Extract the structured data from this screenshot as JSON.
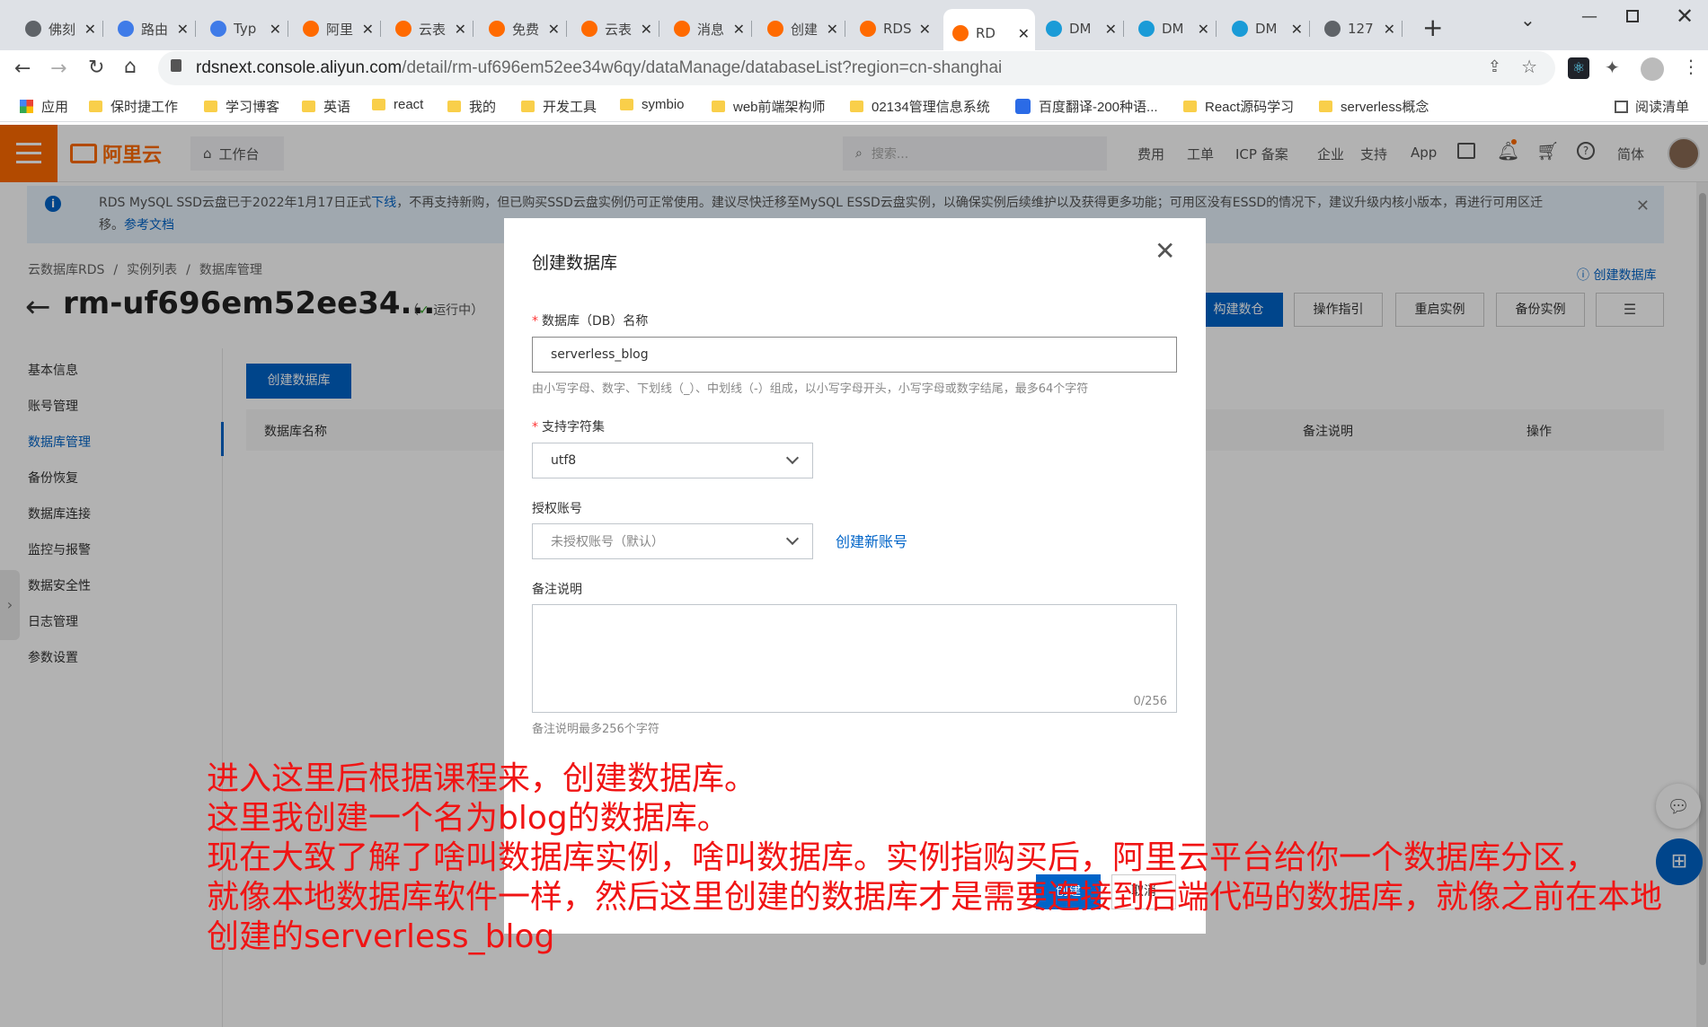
{
  "browser": {
    "tabs": [
      {
        "label": "佛刻",
        "color": "#5f6368"
      },
      {
        "label": "路由",
        "color": "#3f7be8"
      },
      {
        "label": "Typ",
        "color": "#3f7be8"
      },
      {
        "label": "阿里",
        "color": "#ff6a00"
      },
      {
        "label": "云表",
        "color": "#ff6a00"
      },
      {
        "label": "免费",
        "color": "#ff6a00"
      },
      {
        "label": "云表",
        "color": "#ff6a00"
      },
      {
        "label": "消息",
        "color": "#ff6a00"
      },
      {
        "label": "创建",
        "color": "#ff6a00"
      },
      {
        "label": "RDS",
        "color": "#ff6a00"
      },
      {
        "label": "RD",
        "color": "#ff6a00"
      },
      {
        "label": "DM",
        "color": "#1a9bd7"
      },
      {
        "label": "DM",
        "color": "#1a9bd7"
      },
      {
        "label": "DM",
        "color": "#1a9bd7"
      },
      {
        "label": "127",
        "color": "#5f6368"
      }
    ],
    "url_host": "rdsnext.console.aliyun.com",
    "url_path": "/detail/rm-uf696em52ee34w6qy/dataManage/databaseList?region=cn-shanghai",
    "bookmarks": [
      "应用",
      "保时捷工作",
      "学习博客",
      "英语",
      "react",
      "我的",
      "开发工具",
      "symbio",
      "web前端架构师",
      "02134管理信息系统",
      "百度翻译-200种语...",
      "React源码学习",
      "serverless概念"
    ],
    "reading_list": "阅读清单"
  },
  "console": {
    "logo": "阿里云",
    "workbench": "工作台",
    "search_placeholder": "搜索...",
    "nav": [
      "费用",
      "工单",
      "ICP 备案",
      "企业",
      "支持",
      "App"
    ],
    "lang": "简体",
    "notice_a": "RDS MySQL SSD云盘已于2022年1月17日正式",
    "notice_link": "下线",
    "notice_b": "，不再支持新购，但已购买SSD云盘实例仍可正常使用。建议尽快迁移至MySQL ESSD云盘实例，以确保实例后续维护以及获得更多功能；可用区没有ESSD的情况下，建议升级内核小版本，再进行可用区迁",
    "notice_c": "移。",
    "notice_ref": "参考文档",
    "breadcrumb": [
      "云数据库RDS",
      "实例列表",
      "数据库管理"
    ],
    "instance_title": "rm-uf696em52ee34...",
    "status": "运行中",
    "help_link": "创建数据库",
    "actions": [
      "构建数仓",
      "操作指引",
      "重启实例",
      "备份实例"
    ],
    "sidebar": [
      "基本信息",
      "账号管理",
      "数据库管理",
      "备份恢复",
      "数据库连接",
      "监控与报警",
      "数据安全性",
      "日志管理",
      "参数设置"
    ],
    "create_db_btn": "创建数据库",
    "table_headers": [
      "数据库名称",
      "备注说明",
      "操作"
    ]
  },
  "modal": {
    "title": "创建数据库",
    "db_name_label": "数据库（DB）名称",
    "db_name_value": "serverless_blog",
    "db_name_hint": "由小写字母、数字、下划线（_）、中划线（-）组成，以小写字母开头，小写字母或数字结尾，最多64个字符",
    "charset_label": "支持字符集",
    "charset_value": "utf8",
    "account_label": "授权账号",
    "account_value": "未授权账号（默认）",
    "create_account_link": "创建新账号",
    "remark_label": "备注说明",
    "remark_counter": "0/256",
    "remark_hint": "备注说明最多256个字符",
    "create_btn": "创建",
    "cancel_btn": "取消"
  },
  "annotation": [
    "进入这里后根据课程来，创建数据库。",
    "这里我创建一个名为blog的数据库。",
    "现在大致了解了啥叫数据库实例，啥叫数据库。实例指购买后，阿里云平台给你一个数据库分区，",
    "就像本地数据库软件一样，然后这里创建的数据库才是需要连接到后端代码的数据库，就像之前在本地",
    "创建的serverless_blog"
  ]
}
